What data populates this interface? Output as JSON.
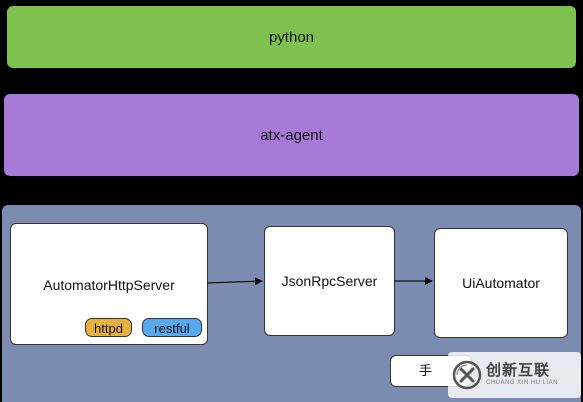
{
  "layers": {
    "python": "python",
    "atx_agent": "atx-agent"
  },
  "nodes": {
    "http_server": "AutomatorHttpServer",
    "rpc_server": "JsonRpcServer",
    "ui_automator": "UiAutomator"
  },
  "badges": {
    "httpd": "httpd",
    "restful": "restful"
  },
  "phone_label": "手",
  "watermark": {
    "cn": "创新互联",
    "en": "CHUANG XIN HU LIAN"
  },
  "colors": {
    "background": "#000000",
    "python_layer": "#7dc24e",
    "atx_layer": "#a77ad8",
    "phone_panel": "#7b8cb0",
    "httpd_badge": "#e6b13f",
    "restful_badge": "#58a9f0"
  },
  "icons": [
    "arrow-right-icon",
    "watermark-logo-icon"
  ]
}
